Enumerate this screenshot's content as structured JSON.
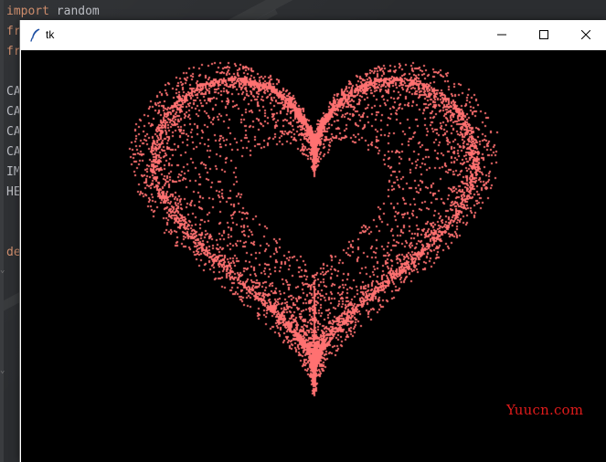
{
  "editor": {
    "lines": [
      {
        "parts": [
          {
            "text": "import",
            "kw": true
          },
          {
            "text": " random",
            "kw": false
          }
        ]
      },
      {
        "parts": [
          {
            "text": "fr",
            "kw": true
          }
        ]
      },
      {
        "parts": [
          {
            "text": "fr",
            "kw": true
          }
        ]
      },
      {
        "parts": [
          {
            "text": "",
            "kw": false
          }
        ]
      },
      {
        "parts": [
          {
            "text": "CA",
            "kw": false
          }
        ]
      },
      {
        "parts": [
          {
            "text": "CA",
            "kw": false
          }
        ]
      },
      {
        "parts": [
          {
            "text": "CA",
            "kw": false
          }
        ]
      },
      {
        "parts": [
          {
            "text": "CA",
            "kw": false
          }
        ]
      },
      {
        "parts": [
          {
            "text": "IM",
            "kw": false
          }
        ]
      },
      {
        "parts": [
          {
            "text": "HE",
            "kw": false
          }
        ]
      },
      {
        "parts": [
          {
            "text": "",
            "kw": false
          }
        ]
      },
      {
        "parts": [
          {
            "text": "",
            "kw": false
          }
        ]
      },
      {
        "parts": [
          {
            "text": "de",
            "kw": true
          }
        ]
      }
    ]
  },
  "window": {
    "title": "tk",
    "icon": "tk-feather-icon",
    "buttons": {
      "minimize": "minimize-icon",
      "maximize": "maximize-icon",
      "close": "close-icon"
    }
  },
  "canvas": {
    "background": "#000000",
    "particle_color": "#ff7171",
    "shape": "heart"
  },
  "watermark": {
    "text": "Yuucn.com",
    "color": "#e01b1b"
  }
}
